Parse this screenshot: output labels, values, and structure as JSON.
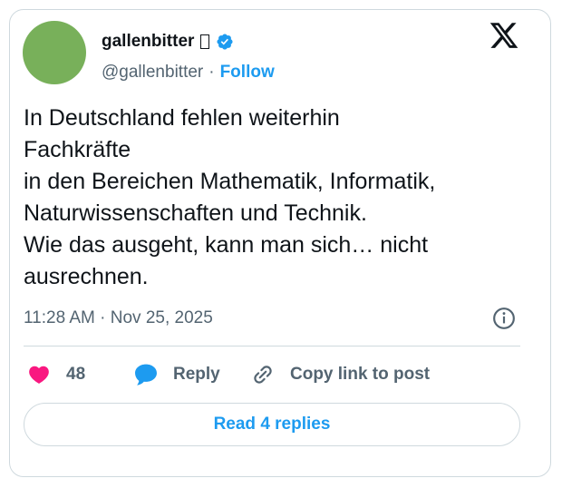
{
  "author": {
    "display_name": "gallenbitter",
    "handle": "@gallenbitter",
    "follow_label": "Follow",
    "separator": "·"
  },
  "tweet": {
    "lines": [
      "In Deutschland fehlen weiterhin",
      "Fachkräfte",
      "in den Bereichen Mathematik, Informatik,",
      "Naturwissenschaften und Technik.",
      "Wie das ausgeht, kann man sich… nicht",
      "ausrechnen."
    ],
    "timestamp": "11:28 AM · Nov 25, 2025"
  },
  "actions": {
    "like_count": "48",
    "reply_label": "Reply",
    "copy_label": "Copy link to post"
  },
  "read_replies_label": "Read 4 replies",
  "icons": {
    "logo": "x-logo-icon",
    "verified": "verified-badge-icon",
    "info": "info-icon",
    "like": "heart-icon",
    "reply": "speech-bubble-icon",
    "copy": "link-icon"
  },
  "colors": {
    "accent": "#1d9bf0",
    "heart": "#f91880",
    "muted": "#536471",
    "avatar": "#78b05a"
  }
}
